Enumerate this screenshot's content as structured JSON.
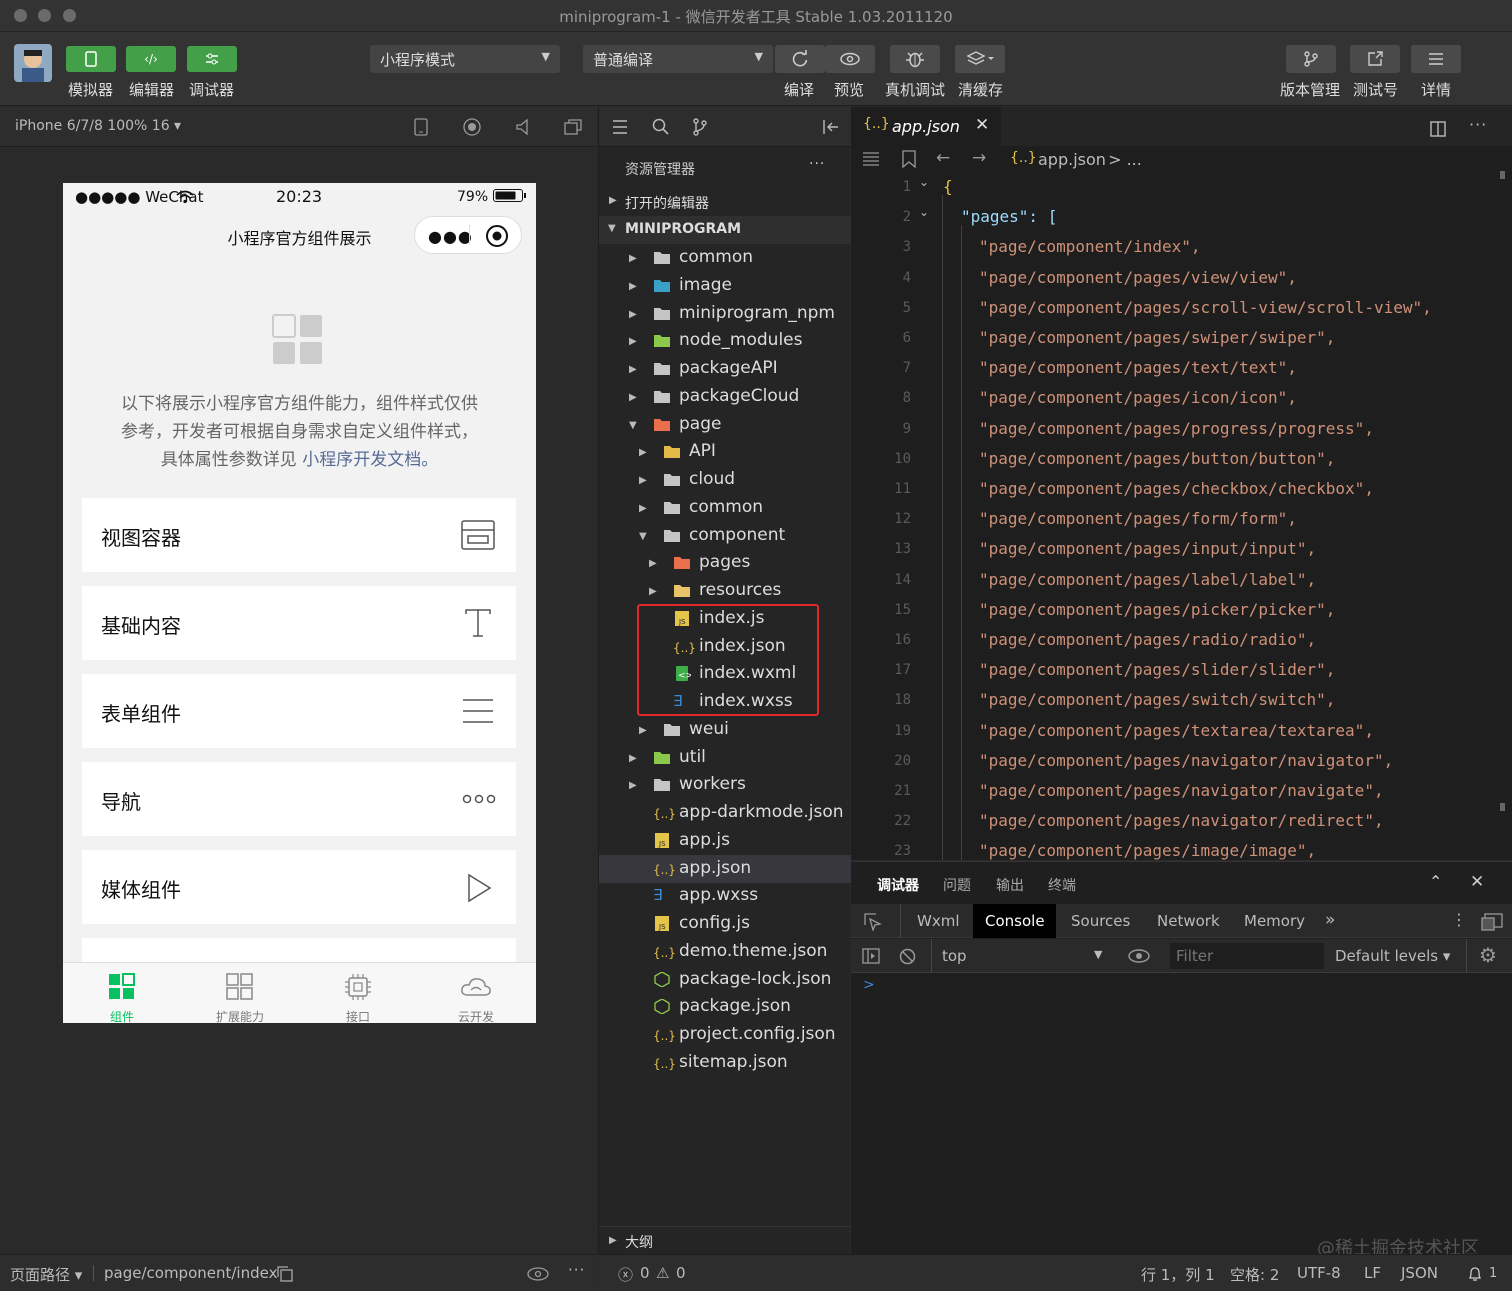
{
  "window": {
    "title": "miniprogram-1 - 微信开发者工具 Stable 1.03.2011120"
  },
  "toolbar": {
    "simulator": "模拟器",
    "editor": "编辑器",
    "debugger": "调试器",
    "mode": "小程序模式",
    "compile_mode": "普通编译",
    "compile": "编译",
    "preview": "预览",
    "remote_debug": "真机调试",
    "clear_cache": "清缓存",
    "version": "版本管理",
    "test_account": "测试号",
    "details": "详情"
  },
  "simulator": {
    "device": "iPhone 6/7/8 100% 16 ▾",
    "status": {
      "carrier": "●●●●● WeChat",
      "time": "20:23",
      "battery": "79%"
    },
    "nav_title": "小程序官方组件展示",
    "intro_line1": "以下将展示小程序官方组件能力，组件样式仅供",
    "intro_line2": "参考，开发者可根据自身需求自定义组件样式，",
    "intro_line3": "具体属性参数详见 ",
    "intro_link": "小程序开发文档。",
    "cards": [
      "视图容器",
      "基础内容",
      "表单组件",
      "导航",
      "媒体组件"
    ],
    "tabs": [
      "组件",
      "扩展能力",
      "接口",
      "云开发"
    ],
    "accent": "#07c160"
  },
  "explorer": {
    "title": "资源管理器",
    "more": "···",
    "open_editors": "打开的编辑器",
    "project": "MINIPROGRAM",
    "outline": "大纲",
    "items": [
      {
        "label": "common",
        "icon": "folder-icon"
      },
      {
        "label": "image",
        "icon": "image-folder-icon"
      },
      {
        "label": "miniprogram_npm",
        "icon": "folder-icon"
      },
      {
        "label": "node_modules",
        "icon": "node-folder-icon"
      },
      {
        "label": "packageAPI",
        "icon": "folder-icon"
      },
      {
        "label": "packageCloud",
        "icon": "folder-icon"
      },
      {
        "label": "page",
        "icon": "page-folder-icon"
      },
      {
        "label": "API",
        "icon": "api-folder-icon"
      },
      {
        "label": "cloud",
        "icon": "folder-icon"
      },
      {
        "label": "common",
        "icon": "folder-icon"
      },
      {
        "label": "component",
        "icon": "folder-open-icon"
      },
      {
        "label": "pages",
        "icon": "page-folder-icon"
      },
      {
        "label": "resources",
        "icon": "resource-folder-icon"
      },
      {
        "label": "index.js",
        "icon": "js-file-icon"
      },
      {
        "label": "index.json",
        "icon": "json-file-icon"
      },
      {
        "label": "index.wxml",
        "icon": "wxml-file-icon"
      },
      {
        "label": "index.wxss",
        "icon": "wxss-file-icon"
      },
      {
        "label": "weui",
        "icon": "folder-icon"
      },
      {
        "label": "util",
        "icon": "util-folder-icon"
      },
      {
        "label": "workers",
        "icon": "folder-icon"
      },
      {
        "label": "app-darkmode.json",
        "icon": "json-file-icon"
      },
      {
        "label": "app.js",
        "icon": "js-file-icon"
      },
      {
        "label": "app.json",
        "icon": "json-file-icon"
      },
      {
        "label": "app.wxss",
        "icon": "wxss-file-icon"
      },
      {
        "label": "config.js",
        "icon": "js-file-icon"
      },
      {
        "label": "demo.theme.json",
        "icon": "json-file-icon"
      },
      {
        "label": "package-lock.json",
        "icon": "npm-file-icon"
      },
      {
        "label": "package.json",
        "icon": "npm-file-icon"
      },
      {
        "label": "project.config.json",
        "icon": "json-file-icon"
      },
      {
        "label": "sitemap.json",
        "icon": "json-file-icon"
      }
    ]
  },
  "editor": {
    "tab": "app.json",
    "breadcrumb_file": "app.json",
    "breadcrumb_more": " > ...",
    "lines": [
      {
        "n": "1",
        "text": "{"
      },
      {
        "n": "2",
        "text": "\"pages\": ["
      },
      {
        "n": "3",
        "text": "\"page/component/index\","
      },
      {
        "n": "4",
        "text": "\"page/component/pages/view/view\","
      },
      {
        "n": "5",
        "text": "\"page/component/pages/scroll-view/scroll-view\","
      },
      {
        "n": "6",
        "text": "\"page/component/pages/swiper/swiper\","
      },
      {
        "n": "7",
        "text": "\"page/component/pages/text/text\","
      },
      {
        "n": "8",
        "text": "\"page/component/pages/icon/icon\","
      },
      {
        "n": "9",
        "text": "\"page/component/pages/progress/progress\","
      },
      {
        "n": "10",
        "text": "\"page/component/pages/button/button\","
      },
      {
        "n": "11",
        "text": "\"page/component/pages/checkbox/checkbox\","
      },
      {
        "n": "12",
        "text": "\"page/component/pages/form/form\","
      },
      {
        "n": "13",
        "text": "\"page/component/pages/input/input\","
      },
      {
        "n": "14",
        "text": "\"page/component/pages/label/label\","
      },
      {
        "n": "15",
        "text": "\"page/component/pages/picker/picker\","
      },
      {
        "n": "16",
        "text": "\"page/component/pages/radio/radio\","
      },
      {
        "n": "17",
        "text": "\"page/component/pages/slider/slider\","
      },
      {
        "n": "18",
        "text": "\"page/component/pages/switch/switch\","
      },
      {
        "n": "19",
        "text": "\"page/component/pages/textarea/textarea\","
      },
      {
        "n": "20",
        "text": "\"page/component/pages/navigator/navigator\","
      },
      {
        "n": "21",
        "text": "\"page/component/pages/navigator/navigate\","
      },
      {
        "n": "22",
        "text": "\"page/component/pages/navigator/redirect\","
      },
      {
        "n": "23",
        "text": "\"page/component/pages/image/image\","
      }
    ]
  },
  "devtools": {
    "panel_tabs": [
      "调试器",
      "问题",
      "输出",
      "终端"
    ],
    "tabs": [
      "Wxml",
      "Console",
      "Sources",
      "Network",
      "Memory"
    ],
    "more": "»",
    "context": "top",
    "filter_placeholder": "Filter",
    "levels": "Default levels ▾",
    "prompt": ">",
    "watermark": "@稀土掘金技术社区"
  },
  "status": {
    "path_label": "页面路径 ▾",
    "path": "page/component/index",
    "errors": "0",
    "warnings": "0",
    "position": "行 1，列 1",
    "spaces": "空格: 2",
    "encoding": "UTF-8",
    "eol": "LF",
    "language": "JSON",
    "notifications": "1"
  }
}
